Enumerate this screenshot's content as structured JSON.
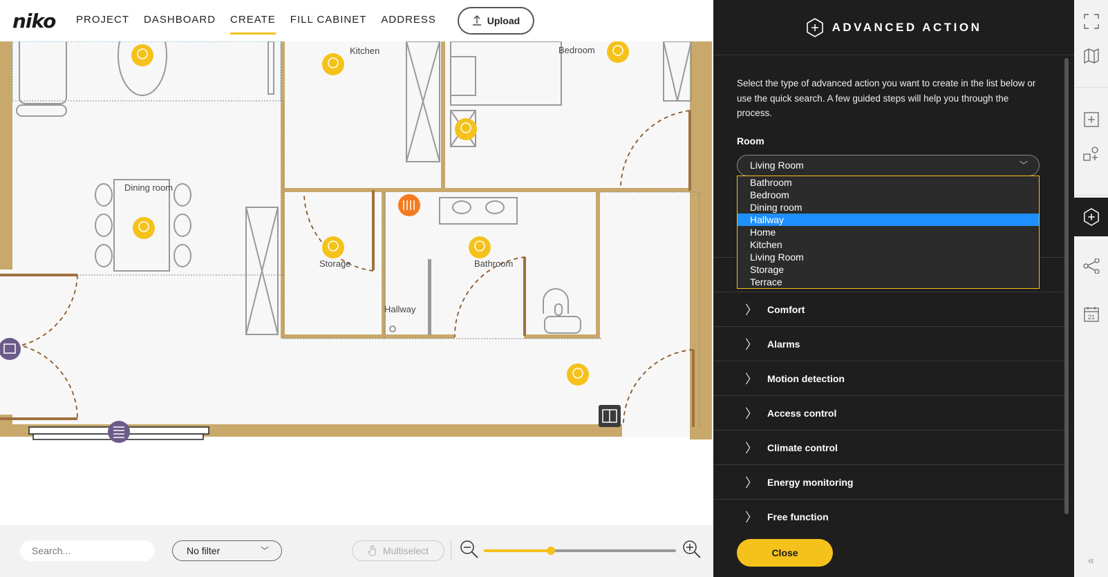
{
  "app": {
    "logo": "niko"
  },
  "nav": {
    "items": [
      {
        "label": "PROJECT",
        "active": false
      },
      {
        "label": "DASHBOARD",
        "active": false
      },
      {
        "label": "CREATE",
        "active": true
      },
      {
        "label": "FILL CABINET",
        "active": false
      },
      {
        "label": "ADDRESS",
        "active": false
      }
    ],
    "upload_label": "Upload"
  },
  "plan": {
    "rooms": {
      "kitchen": "Kitchen",
      "bedroom": "Bedroom",
      "dining": "Dining room",
      "storage": "Storage",
      "bathroom": "Bathroom",
      "hallway": "Hallway"
    }
  },
  "bottom": {
    "search_placeholder": "Search...",
    "filter_value": "No filter",
    "multiselect_label": "Multiselect",
    "zoom_level": 0.35
  },
  "panel": {
    "title": "ADVANCED ACTION",
    "description": "Select the type of advanced action you want to create in the list below or use the quick search. A few guided steps will help you through the process.",
    "room_label": "Room",
    "room_selected": "Living Room",
    "room_options": [
      "Bathroom",
      "Bedroom",
      "Dining room",
      "Hallway",
      "Home",
      "Kitchen",
      "Living Room",
      "Storage",
      "Terrace"
    ],
    "room_highlighted": "Hallway",
    "categories": [
      "Comfort",
      "Alarms",
      "Motion detection",
      "Access control",
      "Climate control",
      "Energy monitoring",
      "Free function"
    ],
    "close_label": "Close"
  },
  "colors": {
    "accent": "#f5c21b",
    "panel_bg": "#1e1e1e",
    "highlight": "#1e90ff",
    "wall": "#c8a86b",
    "device_orange": "#f47b20",
    "device_purple": "#6b5a8a"
  },
  "rail": {
    "icons": [
      "fullscreen-icon",
      "map-icon",
      "add-square-icon",
      "add-shapes-icon",
      "advanced-action-icon",
      "share-nodes-icon",
      "calendar-icon",
      "collapse-icon"
    ],
    "calendar_day": "21"
  }
}
